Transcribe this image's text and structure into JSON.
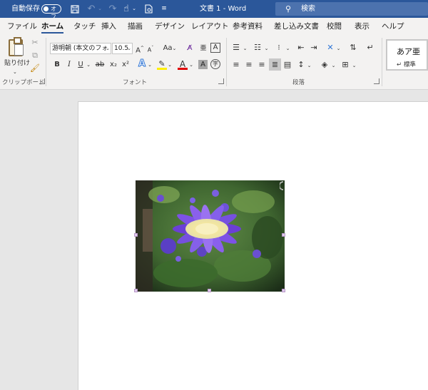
{
  "titlebar": {
    "autosave_label": "自動保存",
    "autosave_state": "オフ",
    "doc_title": "文書 1  -  Word",
    "search_placeholder": "検索"
  },
  "tabs": [
    {
      "label": "ファイル",
      "active": false
    },
    {
      "label": "ホーム",
      "active": true
    },
    {
      "label": "タッチ",
      "active": false
    },
    {
      "label": "挿入",
      "active": false
    },
    {
      "label": "描画",
      "active": false
    },
    {
      "label": "デザイン",
      "active": false
    },
    {
      "label": "レイアウト",
      "active": false
    },
    {
      "label": "参考資料",
      "active": false
    },
    {
      "label": "差し込み文書",
      "active": false
    },
    {
      "label": "校閲",
      "active": false
    },
    {
      "label": "表示",
      "active": false
    },
    {
      "label": "ヘルプ",
      "active": false
    }
  ],
  "ribbon": {
    "clipboard": {
      "paste_label": "貼り付け",
      "group_label": "クリップボード"
    },
    "font": {
      "font_name": "游明朝 (本文のフォ",
      "font_size": "10.5",
      "change_case": "Aa",
      "furigana": "亜",
      "enclose": "A",
      "bold": "B",
      "italic": "I",
      "underline": "U",
      "strike": "ab",
      "subscript": "x₂",
      "superscript": "x²",
      "text_effects": "A",
      "font_color": "A",
      "char_shading": "A",
      "enclose_char": "字",
      "group_label": "フォント",
      "highlight_color": "#ffef00",
      "font_color_value": "#e00000"
    },
    "paragraph": {
      "group_label": "段落"
    },
    "styles": {
      "sample": "あア亜",
      "name": "標準"
    }
  }
}
